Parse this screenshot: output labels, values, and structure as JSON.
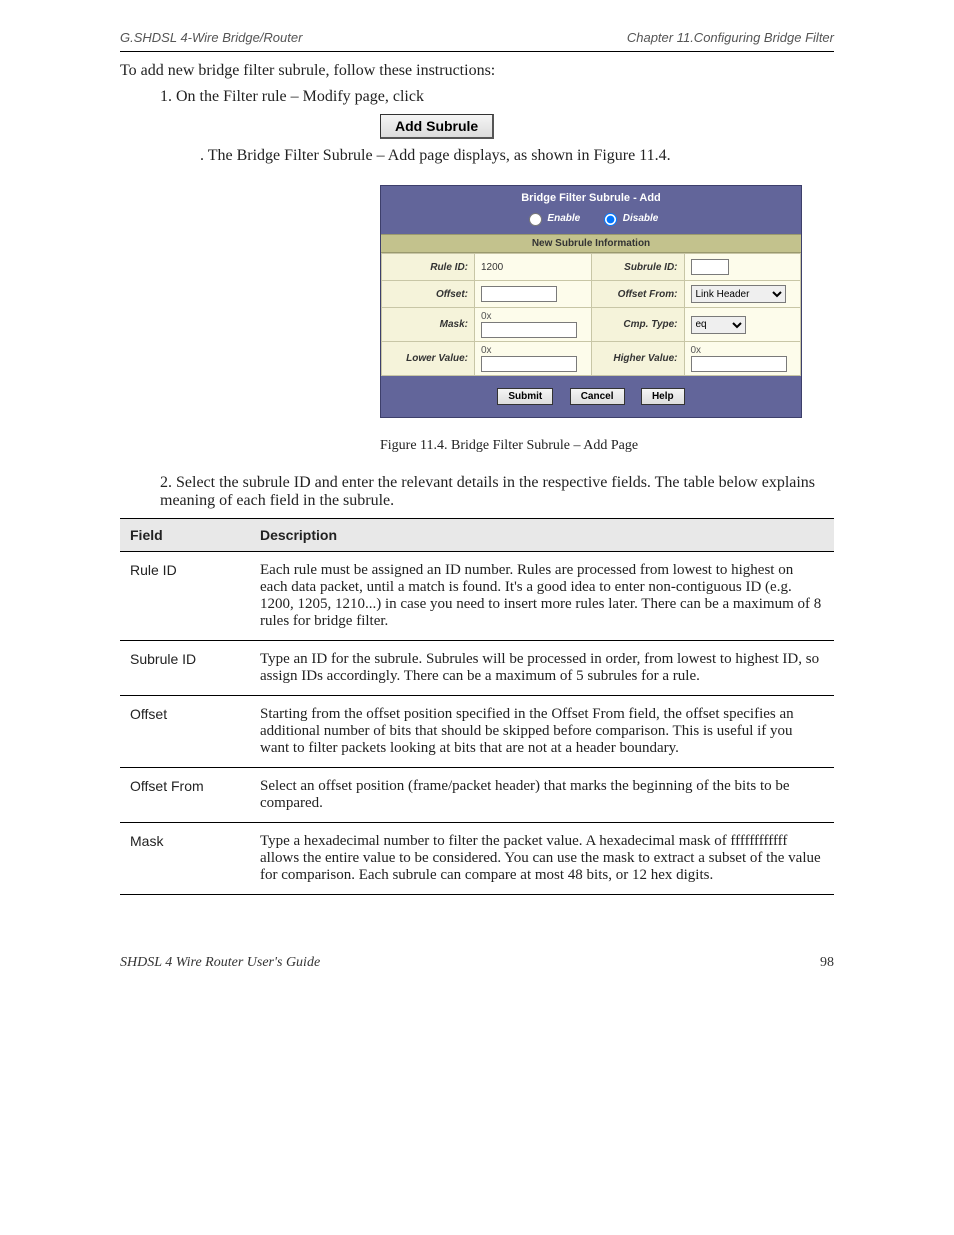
{
  "header": {
    "left": "G.SHDSL 4-Wire Bridge/Router",
    "right": "Chapter 11.Configuring Bridge Filter"
  },
  "intro": "To add new bridge filter subrule, follow these instructions:",
  "step1_a": "1. On the Filter rule – Modify page, click ",
  "step1_b": ". The Bridge Filter Subrule – Add page displays, as shown in Figure 11.4.",
  "button_add_subrule": "Add Subrule",
  "dialog": {
    "title": "Bridge Filter Subrule - Add",
    "enable": "Enable",
    "disable": "Disable",
    "section": "New Subrule Information",
    "labels": {
      "rule_id": "Rule ID:",
      "subrule_id": "Subrule ID:",
      "offset": "Offset:",
      "offset_from": "Offset From:",
      "mask": "Mask:",
      "cmp_type": "Cmp. Type:",
      "lower_value": "Lower Value:",
      "higher_value": "Higher Value:"
    },
    "values": {
      "rule_id": "1200",
      "offset_from": "Link Header",
      "cmp_type": "eq"
    },
    "prefix": "0x",
    "buttons": {
      "submit": "Submit",
      "cancel": "Cancel",
      "help": "Help"
    }
  },
  "figure_caption": "Figure 11.4.  Bridge Filter Subrule – Add Page",
  "instruction2": "2. Select the subrule ID and enter the relevant details in the respective fields. The table below explains meaning of each field in the subrule.",
  "desc_header_field": "Field",
  "desc_header_desc": "Description",
  "desc": [
    {
      "f": "Rule ID",
      "d": "Each rule must be assigned an ID number. Rules are processed from lowest to highest on each data packet, until a match is found. It's a good idea to enter non-contiguous ID (e.g. 1200, 1205, 1210...) in case you need to insert more rules later. There can be a maximum of 8 rules for bridge filter."
    },
    {
      "f": "Subrule ID",
      "d": "Type an ID for the subrule. Subrules will be processed in order, from lowest to highest ID, so assign IDs accordingly. There can be a maximum of 5 subrules for a rule."
    },
    {
      "f": "Offset",
      "d": "Starting from the offset position specified in the Offset From field, the offset specifies an additional number of bits that should be skipped before comparison. This is useful if you want to filter packets looking at bits that are not at a header boundary."
    },
    {
      "f": "Offset From",
      "d": "Select an offset position (frame/packet header) that marks the beginning of the bits to be compared."
    },
    {
      "f": "Mask",
      "d": "Type a hexadecimal number to filter the packet value. A hexadecimal mask of ffffffffffff allows the entire value to be considered. You can use the mask to extract a subset of the value for comparison. Each subrule can compare at most 48 bits, or 12 hex digits."
    }
  ],
  "footer": {
    "left": "SHDSL 4 Wire Router User's Guide",
    "right": "98"
  }
}
